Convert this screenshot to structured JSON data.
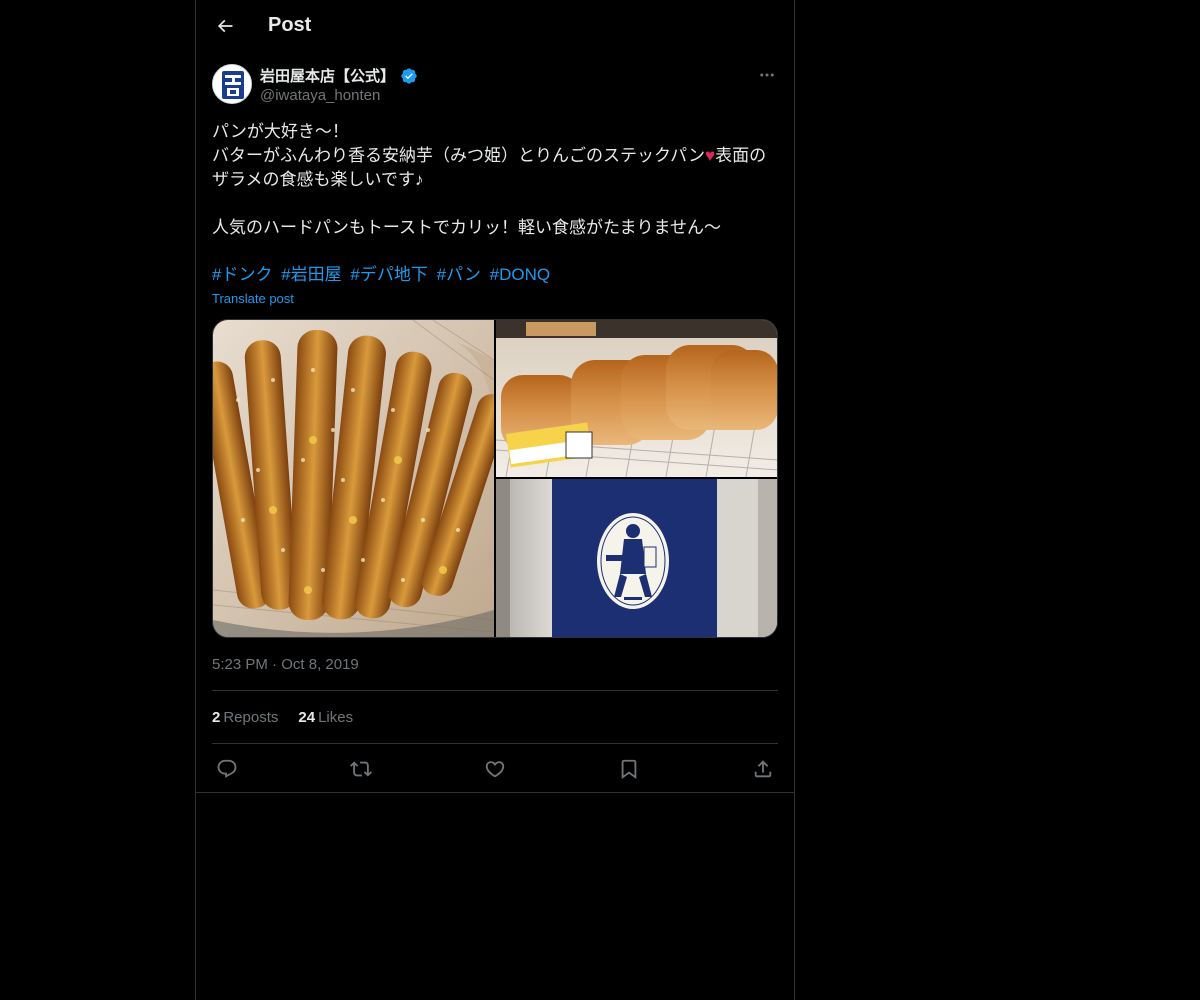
{
  "header": {
    "title": "Post"
  },
  "author": {
    "display_name": "岩田屋本店【公式】",
    "handle": "@iwataya_honten",
    "avatar_glyph": "岩",
    "verified": true
  },
  "tweet": {
    "lines": [
      "パンが大好き〜！",
      "バターがふんわり香る安納芋（みつ姫）とりんごのステックパン❤️表面のザラメの食感も楽しいです♪",
      "",
      "人気のハードパンもトーストでカリッ！軽い食感がたまりません〜"
    ],
    "hashtags": [
      "#ドンク",
      "#岩田屋",
      "#デパ地下",
      "#パン",
      "#DONQ"
    ],
    "translate_label": "Translate post"
  },
  "timestamp": {
    "time": "5:23 PM",
    "separator": "·",
    "date": "Oct 8, 2019"
  },
  "stats": {
    "reposts_count": "2",
    "reposts_label": "Reposts",
    "likes_count": "24",
    "likes_label": "Likes"
  },
  "actions": [
    "reply-icon",
    "repost-icon",
    "like-icon",
    "bookmark-icon",
    "share-icon"
  ],
  "colors": {
    "background": "#000000",
    "text": "#e7e9ea",
    "muted": "#71767b",
    "accent": "#1d9bf0",
    "border": "#2f3336",
    "heart": "#e0245e"
  }
}
